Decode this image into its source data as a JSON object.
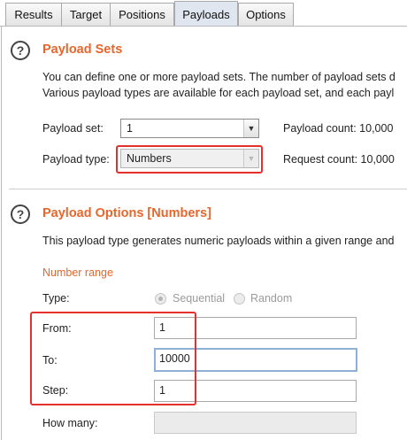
{
  "tabs": [
    "Results",
    "Target",
    "Positions",
    "Payloads",
    "Options"
  ],
  "payload_sets": {
    "help_icon": "?",
    "title": "Payload Sets",
    "desc_line1": "You can define one or more payload sets. The number of payload sets d",
    "desc_line2": "Various payload types are available for each payload set, and each payl",
    "payload_set_label": "Payload set:",
    "payload_set_value": "1",
    "payload_count": "Payload count:  10,000",
    "payload_type_label": "Payload type:",
    "payload_type_value": "Numbers",
    "request_count": "Request count:  10,000"
  },
  "payload_options": {
    "help_icon": "?",
    "title": "Payload Options [Numbers]",
    "desc": "This payload type generates numeric payloads within a given range and",
    "number_range": "Number range",
    "type_label": "Type:",
    "type_options": [
      "Sequential",
      "Random"
    ],
    "type_selected": "Sequential",
    "from_label": "From:",
    "from_value": "1",
    "to_label": "To:",
    "to_value": "10000",
    "step_label": "Step:",
    "step_value": "1",
    "how_many_label": "How many:",
    "how_many_value": ""
  },
  "icons": {
    "combo_arrow": "chevron-down-icon",
    "help": "help-circle-icon"
  },
  "colors": {
    "title": "#e8662b",
    "highlight": "#e5302d",
    "active_tab": "#dfe6ef",
    "focus": "#8fb0d6"
  }
}
